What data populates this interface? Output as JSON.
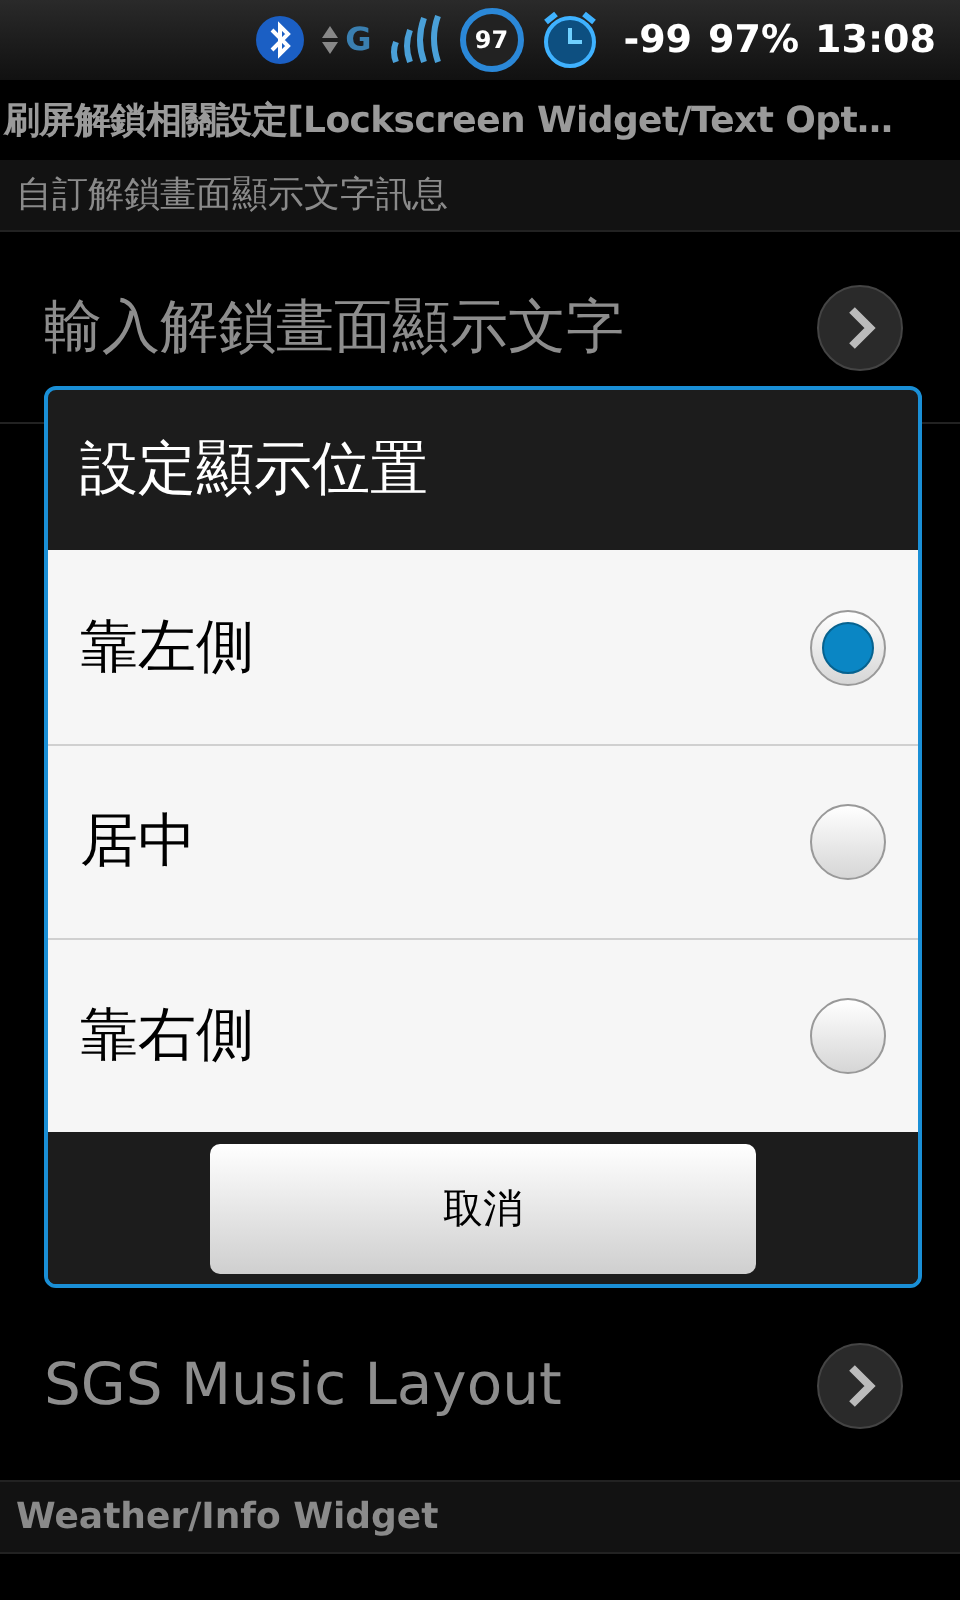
{
  "status_bar": {
    "network": "G",
    "battery_ring": "97",
    "signal": "-99",
    "battery": "97%",
    "time": "13:08"
  },
  "title": "刷屏解鎖相關設定[Lockscreen Widget/Text Opt…",
  "sections_top": [
    {
      "kind": "header",
      "label": "自訂解鎖畫面顯示文字訊息"
    },
    {
      "kind": "link",
      "label": "輸入解鎖畫面顯示文字"
    }
  ],
  "sections_bottom": [
    {
      "kind": "link",
      "label": "SGS Music Layout"
    },
    {
      "kind": "header",
      "label": "Weather/Info Widget"
    }
  ],
  "dialog": {
    "title": "設定顯示位置",
    "options": [
      {
        "label": "靠左側",
        "selected": true
      },
      {
        "label": "居中",
        "selected": false
      },
      {
        "label": "靠右側",
        "selected": false
      }
    ],
    "cancel": "取消"
  }
}
